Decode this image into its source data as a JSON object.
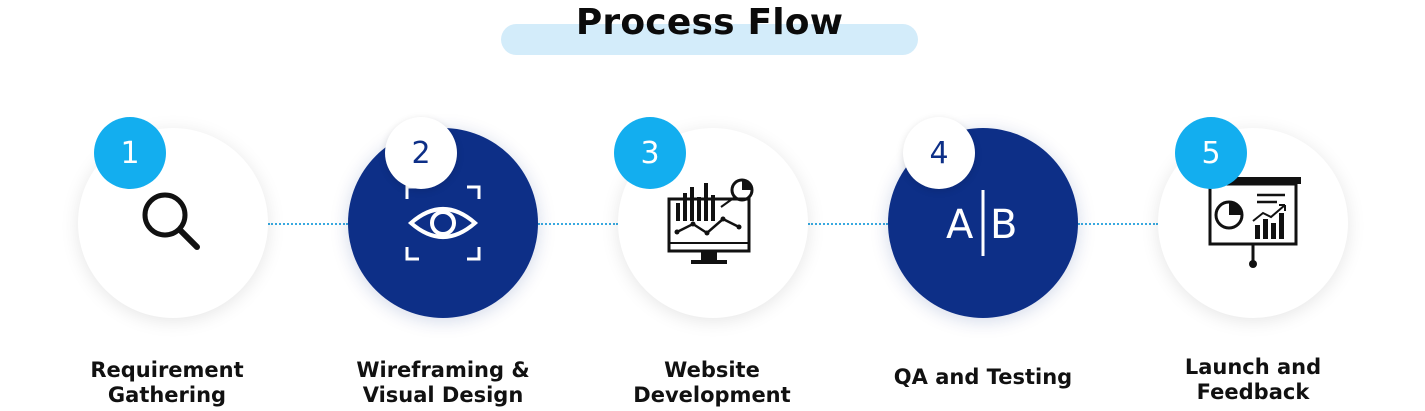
{
  "title": "Process Flow",
  "colors": {
    "accent_blue": "#13aeef",
    "navy": "#0d2f87",
    "title_pill": "#d3ecfa",
    "connector": "#38a9e0"
  },
  "steps": [
    {
      "number": "1",
      "label": "Requirement\nGathering",
      "icon": "magnifier-icon"
    },
    {
      "number": "2",
      "label": "Wireframing &\nVisual Design",
      "icon": "eye-scan-icon"
    },
    {
      "number": "3",
      "label": "Website\nDevelopment",
      "icon": "analytics-monitor-icon"
    },
    {
      "number": "4",
      "label": "QA and Testing",
      "icon": "ab-test-icon",
      "icon_text": "A|B"
    },
    {
      "number": "5",
      "label": "Launch and\nFeedback",
      "icon": "presentation-board-icon"
    }
  ]
}
